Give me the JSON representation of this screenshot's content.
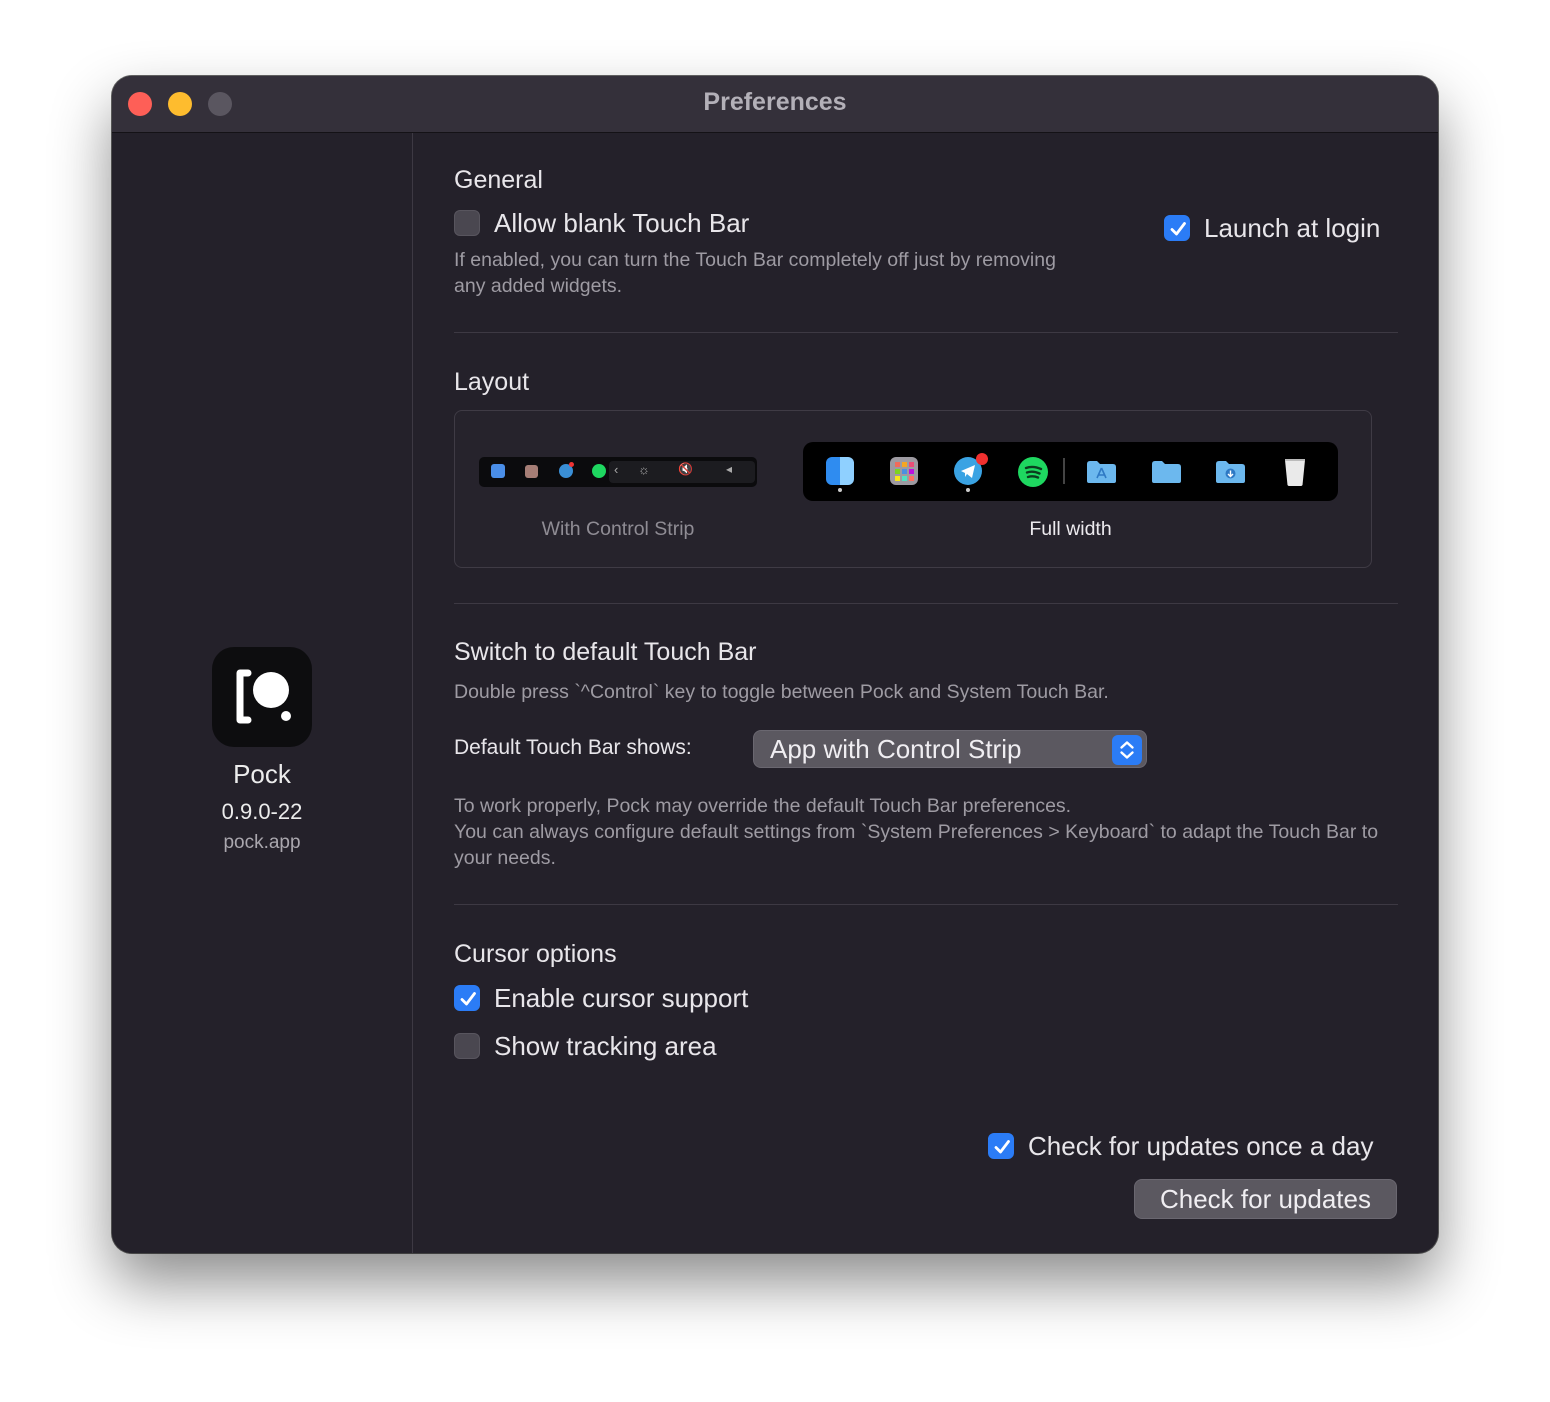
{
  "window": {
    "title": "Preferences"
  },
  "sidebar": {
    "app_name": "Pock",
    "app_version": "0.9.0-22",
    "app_site": "pock.app",
    "icon": "pock-app-icon"
  },
  "general": {
    "title": "General",
    "allow_blank": {
      "label": "Allow blank Touch Bar",
      "checked": false
    },
    "allow_blank_desc": "If enabled, you can turn the Touch Bar completely off just by removing any added widgets.",
    "launch_at_login": {
      "label": "Launch at login",
      "checked": true
    }
  },
  "layout": {
    "title": "Layout",
    "options": [
      {
        "label": "With Control Strip",
        "selected": false
      },
      {
        "label": "Full width",
        "selected": true
      }
    ]
  },
  "switch": {
    "title": "Switch to default Touch Bar",
    "desc": "Double press `^Control` key to toggle between Pock and System Touch Bar.",
    "shows_label": "Default Touch Bar shows:",
    "shows_value": "App with Control Strip",
    "note": "To work properly, Pock may override the default Touch Bar preferences.\nYou can always configure default settings from `System Preferences > Keyboard` to adapt the Touch Bar to your needs."
  },
  "cursor": {
    "title": "Cursor options",
    "enable": {
      "label": "Enable cursor support",
      "checked": true
    },
    "tracking": {
      "label": "Show tracking area",
      "checked": false
    }
  },
  "updates": {
    "auto": {
      "label": "Check for updates once a day",
      "checked": true
    },
    "button": "Check for updates"
  },
  "colors": {
    "window_bg": "#24212a",
    "accent": "#2b7cf6",
    "close": "#fe5f57",
    "minimize": "#febc2e"
  }
}
